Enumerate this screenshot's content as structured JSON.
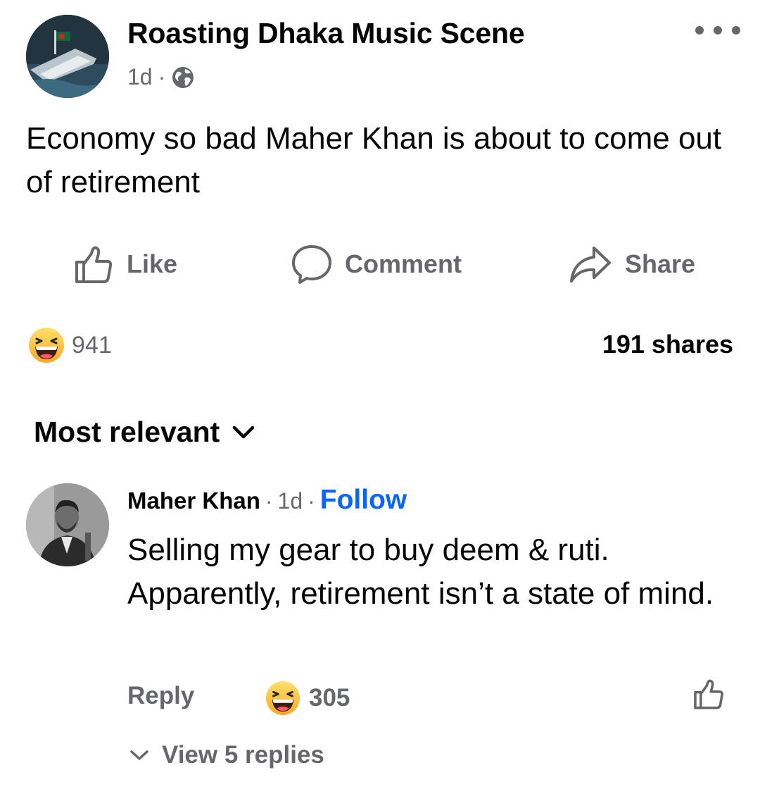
{
  "post": {
    "page_name": "Roasting Dhaka Music Scene",
    "time": "1d",
    "separator": "·",
    "privacy_icon": "globe-icon",
    "text": "Economy so bad Maher Khan is about to come out of retirement"
  },
  "actions": {
    "like": "Like",
    "comment": "Comment",
    "share": "Share"
  },
  "stats": {
    "reaction_emoji": "haha",
    "reaction_count": "941",
    "shares": "191 shares"
  },
  "sort": {
    "label": "Most relevant"
  },
  "comment": {
    "author": "Maher Khan",
    "time": "1d",
    "separator": "·",
    "follow": "Follow",
    "text": "Selling my gear to buy deem & ruti. Apparently, retirement isn’t a state of mind.",
    "reply": "Reply",
    "reaction_count": "305",
    "view_replies": "View 5 replies"
  },
  "colors": {
    "accent": "#0866ff",
    "secondary_text": "#65676b",
    "primary_text": "#050505"
  }
}
